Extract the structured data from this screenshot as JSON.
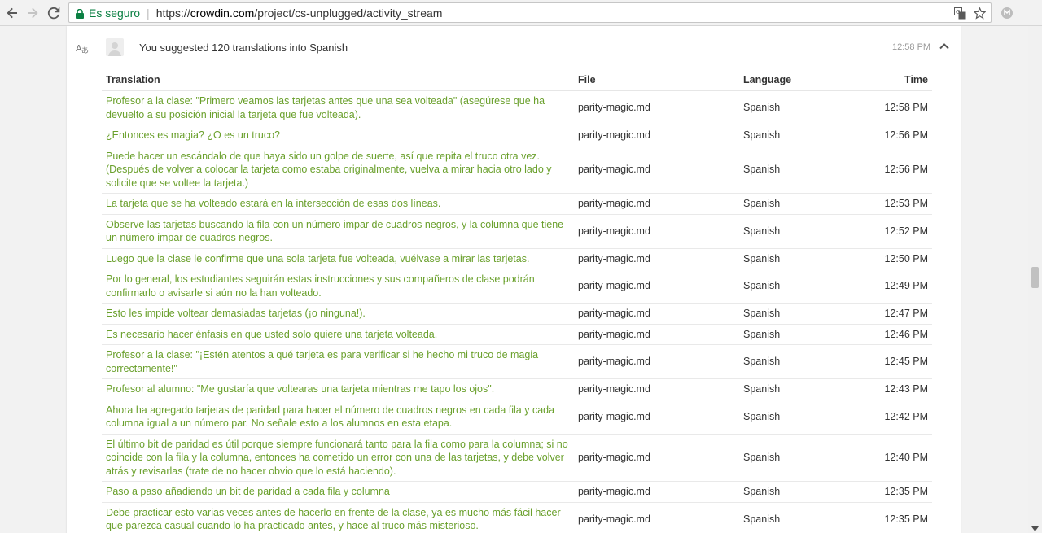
{
  "browser": {
    "secure_label": "Es seguro",
    "url_prefix": "https://",
    "url_host": "crowdin.com",
    "url_path": "/project/cs-unplugged/activity_stream"
  },
  "activity": {
    "title": "You suggested 120 translations into Spanish",
    "timestamp": "12:58 PM"
  },
  "table": {
    "headers": {
      "translation": "Translation",
      "file": "File",
      "language": "Language",
      "time": "Time"
    },
    "rows": [
      {
        "translation": "Profesor a la clase: \"Primero veamos las tarjetas antes que una sea volteada\" (asegúrese que ha devuelto a su posición inicial la tarjeta que fue volteada).",
        "file": "parity-magic.md",
        "language": "Spanish",
        "time": "12:58 PM"
      },
      {
        "translation": "¿Entonces es magia? ¿O es un truco?",
        "file": "parity-magic.md",
        "language": "Spanish",
        "time": "12:56 PM"
      },
      {
        "translation": "Puede hacer un escándalo de que haya sido un golpe de suerte, así que repita el truco otra vez. (Después de volver a colocar la tarjeta como estaba originalmente, vuelva a mirar hacia otro lado y solicite que se voltee la tarjeta.)",
        "file": "parity-magic.md",
        "language": "Spanish",
        "time": "12:56 PM"
      },
      {
        "translation": "La tarjeta que se ha volteado estará en la intersección de esas dos líneas.",
        "file": "parity-magic.md",
        "language": "Spanish",
        "time": "12:53 PM"
      },
      {
        "translation": "Observe las tarjetas buscando la fila con un número impar de cuadros negros, y la columna que tiene un número impar de cuadros negros.",
        "file": "parity-magic.md",
        "language": "Spanish",
        "time": "12:52 PM"
      },
      {
        "translation": "Luego que la clase le confirme que una sola tarjeta fue volteada, vuélvase a mirar las tarjetas.",
        "file": "parity-magic.md",
        "language": "Spanish",
        "time": "12:50 PM"
      },
      {
        "translation": "Por lo general, los estudiantes seguirán estas instrucciones y sus compañeros de clase podrán confirmarlo o avisarle si aún no la han volteado.",
        "file": "parity-magic.md",
        "language": "Spanish",
        "time": "12:49 PM"
      },
      {
        "translation": "Esto les impide voltear demasiadas tarjetas (¡o ninguna!).",
        "file": "parity-magic.md",
        "language": "Spanish",
        "time": "12:47 PM"
      },
      {
        "translation": "Es necesario hacer énfasis en que usted solo quiere una tarjeta volteada.",
        "file": "parity-magic.md",
        "language": "Spanish",
        "time": "12:46 PM"
      },
      {
        "translation": "Profesor a la clase: \"¡Estén atentos a qué tarjeta es para verificar si he hecho mi truco de magia correctamente!\"",
        "file": "parity-magic.md",
        "language": "Spanish",
        "time": "12:45 PM"
      },
      {
        "translation": "Profesor al alumno: \"Me gustaría que voltearas una tarjeta mientras me tapo los ojos\".",
        "file": "parity-magic.md",
        "language": "Spanish",
        "time": "12:43 PM"
      },
      {
        "translation": "Ahora ha agregado tarjetas de paridad para hacer el número de cuadros negros en cada fila y cada columna igual a un número par. No señale esto a los alumnos en esta etapa.",
        "file": "parity-magic.md",
        "language": "Spanish",
        "time": "12:42 PM"
      },
      {
        "translation": "El último bit de paridad es útil porque siempre funcionará tanto para la fila como para la columna; si no coincide con la fila y la columna, entonces ha cometido un error con una de las tarjetas, y debe volver atrás y revisarlas (trate de no hacer obvio que lo está haciendo).",
        "file": "parity-magic.md",
        "language": "Spanish",
        "time": "12:40 PM"
      },
      {
        "translation": "Paso a paso añadiendo un bit de paridad a cada fila y columna",
        "file": "parity-magic.md",
        "language": "Spanish",
        "time": "12:35 PM"
      },
      {
        "translation": "Debe practicar esto varias veces antes de hacerlo en frente de la clase, ya es mucho más fácil hacer que parezca casual cuando lo ha practicado antes, y hace al truco más misterioso.",
        "file": "parity-magic.md",
        "language": "Spanish",
        "time": "12:35 PM"
      }
    ]
  },
  "colors": {
    "translation_text": "#6aa02c",
    "secure_text": "#0b8043"
  }
}
